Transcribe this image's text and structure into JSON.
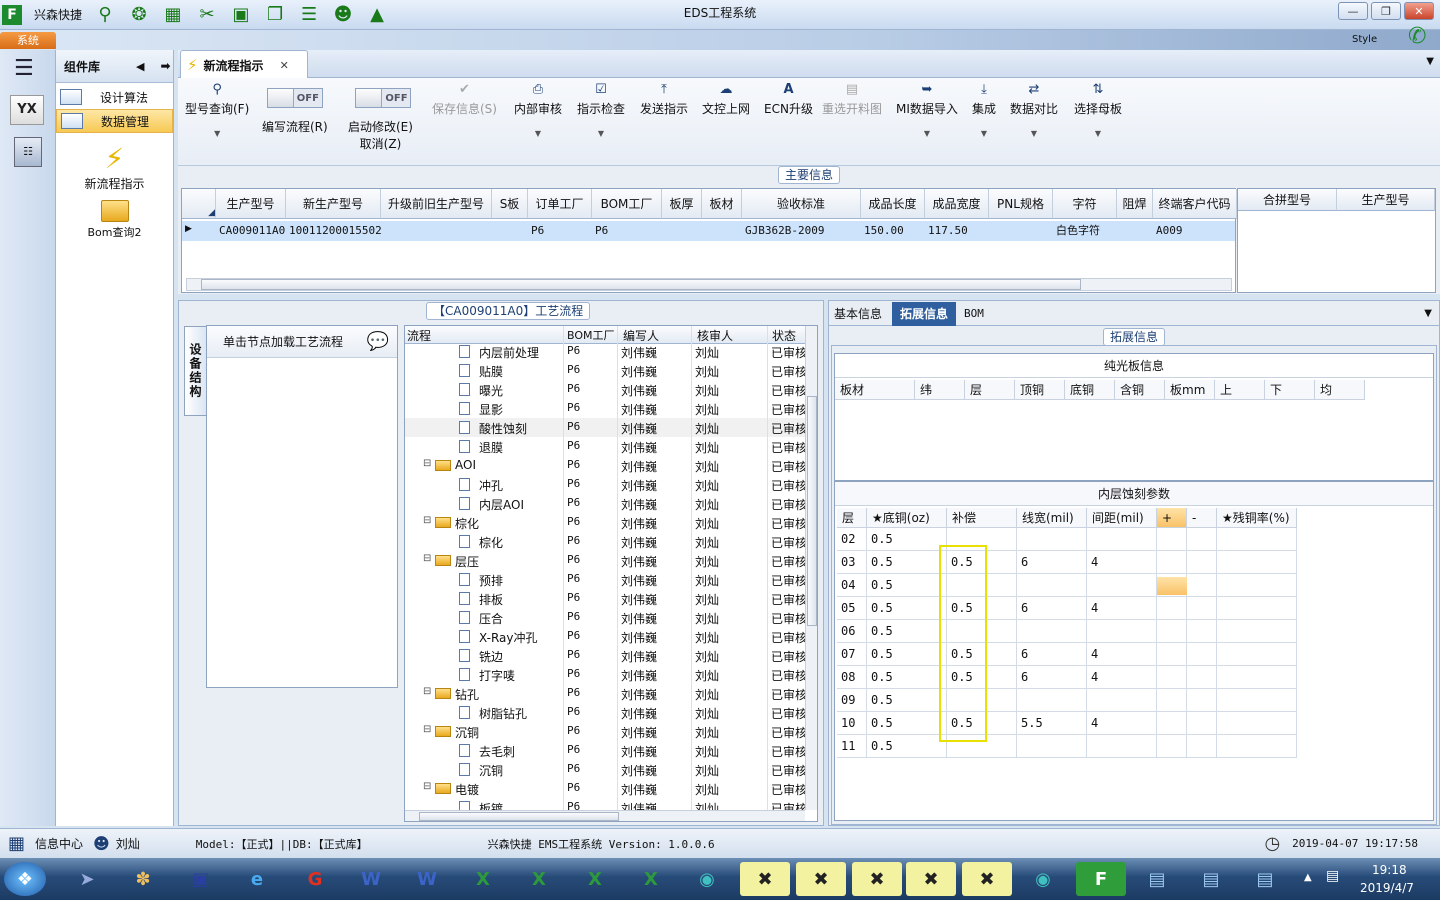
{
  "app": {
    "name": "兴森快捷",
    "window_title": "EDS工程系统",
    "style_label": "Style",
    "system_tab": "系统"
  },
  "colors": {
    "accent": "#1d3f74",
    "selection": "#cde3fb",
    "highlight_box": "#e8e000"
  },
  "component_panel": {
    "title": "组件库",
    "items": [
      {
        "label": "设计算法"
      },
      {
        "label": "数据管理"
      }
    ],
    "launchers": [
      {
        "label": "新流程指示"
      },
      {
        "label": "Bom查询2"
      }
    ]
  },
  "tab": {
    "label": "新流程指示"
  },
  "toolbar": {
    "model_query": "型号查询(F)",
    "edit_flow": "编写流程(R)",
    "start_modify": "启动修改(E)",
    "cancel": "取消(Z)",
    "off": "OFF",
    "save_info": "保存信息(S)",
    "internal_review": "内部审核",
    "instruction_check": "指示检查",
    "send_instruction": "发送指示",
    "doc_upload": "文控上网",
    "ecn_upgrade": "ECN升级",
    "reselect_material": "重选开料图",
    "mi_import": "MI数据导入",
    "integrate": "集成",
    "data_compare": "数据对比",
    "select_mother": "选择母板"
  },
  "main_info": {
    "title": "主要信息",
    "columns": [
      "生产型号",
      "新生产型号",
      "升级前旧生产型号",
      "S板",
      "订单工厂",
      "BOM工厂",
      "板厚",
      "板材",
      "验收标准",
      "成品长度",
      "成品宽度",
      "PNL规格",
      "字符",
      "阻焊",
      "终端客户代码"
    ],
    "row": {
      "prod_model": "CA009011A0",
      "new_model": "10011200015502",
      "old_model": "",
      "s_board": "",
      "order_factory": "P6",
      "bom_factory": "P6",
      "thickness": "",
      "material": "",
      "standard": "GJB362B-2009",
      "length": "150.00",
      "width": "117.50",
      "pnl": "",
      "character": "白色字符",
      "solder_mask": "",
      "customer_code": "A009"
    },
    "right_columns": [
      "合拼型号",
      "生产型号"
    ]
  },
  "process": {
    "title": "【CA009011A0】工艺流程",
    "side_tab": "设备结构",
    "node_hint": "单击节点加载工艺流程",
    "columns": [
      "流程",
      "BOM工厂",
      "编写人",
      "核审人",
      "状态"
    ],
    "rows": [
      {
        "name": "内层前处理",
        "level": 2,
        "folder": false,
        "bom": "P6",
        "writer": "刘伟巍",
        "reviewer": "刘灿",
        "status": "已审核"
      },
      {
        "name": "贴膜",
        "level": 2,
        "folder": false,
        "bom": "P6",
        "writer": "刘伟巍",
        "reviewer": "刘灿",
        "status": "已审核"
      },
      {
        "name": "曝光",
        "level": 2,
        "folder": false,
        "bom": "P6",
        "writer": "刘伟巍",
        "reviewer": "刘灿",
        "status": "已审核"
      },
      {
        "name": "显影",
        "level": 2,
        "folder": false,
        "bom": "P6",
        "writer": "刘伟巍",
        "reviewer": "刘灿",
        "status": "已审核"
      },
      {
        "name": "酸性蚀刻",
        "level": 2,
        "folder": false,
        "bom": "P6",
        "writer": "刘伟巍",
        "reviewer": "刘灿",
        "status": "已审核",
        "selected": true
      },
      {
        "name": "退膜",
        "level": 2,
        "folder": false,
        "bom": "P6",
        "writer": "刘伟巍",
        "reviewer": "刘灿",
        "status": "已审核"
      },
      {
        "name": "AOI",
        "level": 1,
        "folder": true,
        "bom": "P6",
        "writer": "刘伟巍",
        "reviewer": "刘灿",
        "status": "已审核"
      },
      {
        "name": "冲孔",
        "level": 2,
        "folder": false,
        "bom": "P6",
        "writer": "刘伟巍",
        "reviewer": "刘灿",
        "status": "已审核"
      },
      {
        "name": "内层AOI",
        "level": 2,
        "folder": false,
        "bom": "P6",
        "writer": "刘伟巍",
        "reviewer": "刘灿",
        "status": "已审核"
      },
      {
        "name": "棕化",
        "level": 1,
        "folder": true,
        "bom": "P6",
        "writer": "刘伟巍",
        "reviewer": "刘灿",
        "status": "已审核"
      },
      {
        "name": "棕化",
        "level": 2,
        "folder": false,
        "bom": "P6",
        "writer": "刘伟巍",
        "reviewer": "刘灿",
        "status": "已审核"
      },
      {
        "name": "层压",
        "level": 1,
        "folder": true,
        "bom": "P6",
        "writer": "刘伟巍",
        "reviewer": "刘灿",
        "status": "已审核"
      },
      {
        "name": "预排",
        "level": 2,
        "folder": false,
        "bom": "P6",
        "writer": "刘伟巍",
        "reviewer": "刘灿",
        "status": "已审核"
      },
      {
        "name": "排板",
        "level": 2,
        "folder": false,
        "bom": "P6",
        "writer": "刘伟巍",
        "reviewer": "刘灿",
        "status": "已审核"
      },
      {
        "name": "压合",
        "level": 2,
        "folder": false,
        "bom": "P6",
        "writer": "刘伟巍",
        "reviewer": "刘灿",
        "status": "已审核"
      },
      {
        "name": "X-Ray冲孔",
        "level": 2,
        "folder": false,
        "bom": "P6",
        "writer": "刘伟巍",
        "reviewer": "刘灿",
        "status": "已审核"
      },
      {
        "name": "铣边",
        "level": 2,
        "folder": false,
        "bom": "P6",
        "writer": "刘伟巍",
        "reviewer": "刘灿",
        "status": "已审核"
      },
      {
        "name": "打字唛",
        "level": 2,
        "folder": false,
        "bom": "P6",
        "writer": "刘伟巍",
        "reviewer": "刘灿",
        "status": "已审核"
      },
      {
        "name": "钻孔",
        "level": 1,
        "folder": true,
        "bom": "P6",
        "writer": "刘伟巍",
        "reviewer": "刘灿",
        "status": "已审核"
      },
      {
        "name": "树脂钻孔",
        "level": 2,
        "folder": false,
        "bom": "P6",
        "writer": "刘伟巍",
        "reviewer": "刘灿",
        "status": "已审核"
      },
      {
        "name": "沉铜",
        "level": 1,
        "folder": true,
        "bom": "P6",
        "writer": "刘伟巍",
        "reviewer": "刘灿",
        "status": "已审核"
      },
      {
        "name": "去毛刺",
        "level": 2,
        "folder": false,
        "bom": "P6",
        "writer": "刘伟巍",
        "reviewer": "刘灿",
        "status": "已审核"
      },
      {
        "name": "沉铜",
        "level": 2,
        "folder": false,
        "bom": "P6",
        "writer": "刘伟巍",
        "reviewer": "刘灿",
        "status": "已审核"
      },
      {
        "name": "电镀",
        "level": 1,
        "folder": true,
        "bom": "P6",
        "writer": "刘伟巍",
        "reviewer": "刘灿",
        "status": "已审核"
      },
      {
        "name": "板镀",
        "level": 2,
        "folder": false,
        "bom": "P6",
        "writer": "刘伟巍",
        "reviewer": "刘灿",
        "status": "已审核"
      }
    ]
  },
  "detail_tabs": [
    "基本信息",
    "拓展信息",
    "BOM"
  ],
  "extended": {
    "title": "拓展信息",
    "plain_board": {
      "title": "纯光板信息",
      "columns": [
        "板材",
        "纬",
        "层",
        "顶铜",
        "底铜",
        "含铜",
        "板mm",
        "上",
        "下",
        "均"
      ]
    },
    "inner_etch": {
      "title": "内层蚀刻参数",
      "columns": [
        "层",
        "★底铜(oz)",
        "补偿",
        "线宽(mil)",
        "间距(mil)",
        "+",
        "-",
        "★残铜率(%)"
      ],
      "rows": [
        {
          "layer": "02",
          "base": "0.5",
          "comp": "",
          "width": "",
          "spacing": ""
        },
        {
          "layer": "03",
          "base": "0.5",
          "comp": "0.5",
          "width": "6",
          "spacing": "4"
        },
        {
          "layer": "04",
          "base": "0.5",
          "comp": "",
          "width": "",
          "spacing": ""
        },
        {
          "layer": "05",
          "base": "0.5",
          "comp": "0.5",
          "width": "6",
          "spacing": "4"
        },
        {
          "layer": "06",
          "base": "0.5",
          "comp": "",
          "width": "",
          "spacing": ""
        },
        {
          "layer": "07",
          "base": "0.5",
          "comp": "0.5",
          "width": "6",
          "spacing": "4"
        },
        {
          "layer": "08",
          "base": "0.5",
          "comp": "0.5",
          "width": "6",
          "spacing": "4"
        },
        {
          "layer": "09",
          "base": "0.5",
          "comp": "",
          "width": "",
          "spacing": ""
        },
        {
          "layer": "10",
          "base": "0.5",
          "comp": "0.5",
          "width": "5.5",
          "spacing": "4"
        },
        {
          "layer": "11",
          "base": "0.5",
          "comp": "",
          "width": "",
          "spacing": ""
        }
      ]
    }
  },
  "status": {
    "info_center": "信息中心",
    "user": "刘灿",
    "model": "Model:【正式】||DB:【正式库】",
    "version": "兴森快捷 EMS工程系统 Version: 1.0.0.6",
    "datetime": "2019-04-07 19:17:58"
  },
  "taskbar": {
    "time": "19:18",
    "date": "2019/4/7"
  }
}
